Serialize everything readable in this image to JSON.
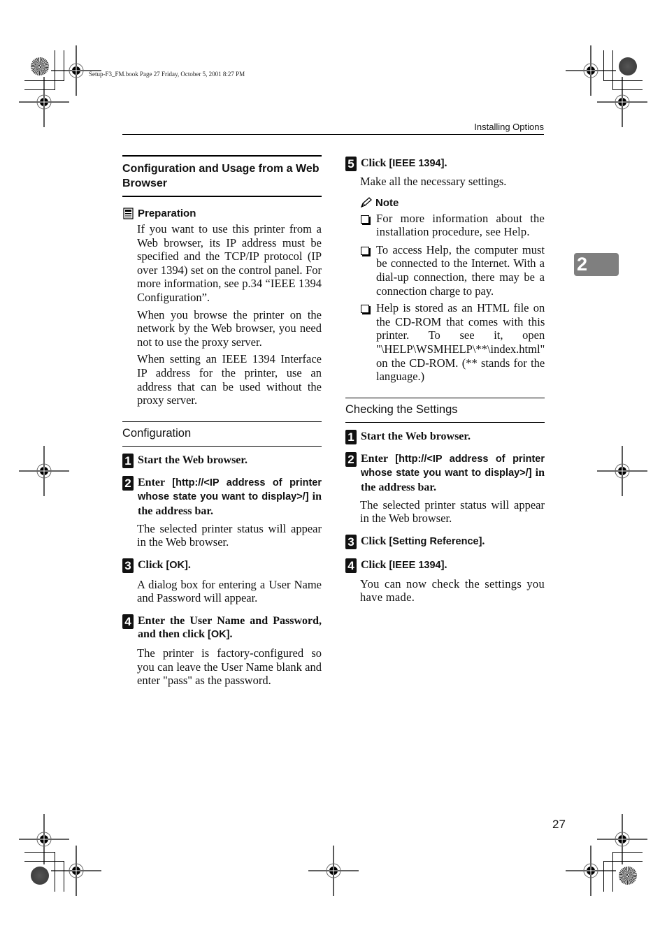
{
  "slug": "Setup-F3_FM.book  Page 27  Friday, October 5, 2001  8:27 PM",
  "running_head": "Installing Options",
  "chapter_tab": "2",
  "page_number": "27",
  "left": {
    "section_title": "Configuration and Usage from a Web Browser",
    "preparation": {
      "label": "Preparation",
      "icon": "preparation-icon",
      "paragraphs": [
        "If you want to use this printer from a Web browser, its IP address must be specified and the TCP/IP protocol (IP over 1394) set on the control panel. For more information, see p.34 “IEEE 1394 Configuration”.",
        "When you browse the printer on the network by the Web browser, you need not to use the proxy server.",
        "When setting an IEEE 1394 Interface IP address for the printer, use an address that can be used without the proxy server."
      ]
    },
    "subsection_title": "Configuration",
    "steps": [
      {
        "num": "1",
        "pre": "Start the Web browser.",
        "kw": "",
        "post": "",
        "desc": ""
      },
      {
        "num": "2",
        "pre": "Enter ",
        "kw": "[http://<IP address of printer whose state you want to display>/]",
        "post": " in the address bar.",
        "desc": "The selected printer status will appear in the Web browser."
      },
      {
        "num": "3",
        "pre": "Click ",
        "kw": "[OK]",
        "post": ".",
        "desc": "A dialog box for entering a User Name and Password will appear."
      },
      {
        "num": "4",
        "pre": "Enter the User Name and Password, and then click ",
        "kw": "[OK]",
        "post": ".",
        "desc": "The printer is factory-configured so you can leave the User Name blank and enter \"pass\" as the password."
      }
    ]
  },
  "right": {
    "step5": {
      "num": "5",
      "pre": "Click ",
      "kw": "[IEEE 1394]",
      "post": ".",
      "desc": "Make all the necessary settings."
    },
    "note": {
      "label": "Note",
      "icon": "pencil-icon",
      "items": [
        "For more information about the installation procedure, see Help.",
        "To access Help, the computer must be connected to the Internet. With a dial-up connection, there may be a connection charge to pay.",
        "Help is stored as an HTML file on the CD-ROM that comes with this printer. To see it, open \"\\HELP\\WSMHELP\\**\\index.html\" on the CD-ROM. (** stands for the language.)"
      ]
    },
    "subsection_title": "Checking the Settings",
    "steps": [
      {
        "num": "1",
        "pre": "Start the Web browser.",
        "kw": "",
        "post": "",
        "desc": ""
      },
      {
        "num": "2",
        "pre": "Enter ",
        "kw": "[http://<IP address of printer whose state you want to display>/]",
        "post": " in the address bar.",
        "desc": "The selected printer status will appear in the Web browser."
      },
      {
        "num": "3",
        "pre": "Click ",
        "kw": "[Setting Reference]",
        "post": ".",
        "desc": ""
      },
      {
        "num": "4",
        "pre": "Click ",
        "kw": "[IEEE 1394]",
        "post": ".",
        "desc": "You can now check the settings you have made."
      }
    ]
  }
}
